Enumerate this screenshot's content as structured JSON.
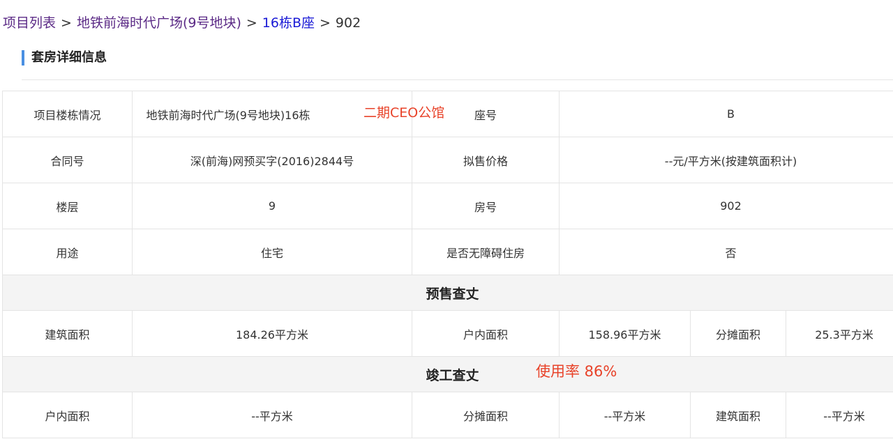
{
  "breadcrumb": {
    "items": [
      "项目列表",
      "地铁前海时代广场(9号地块)",
      "16栋B座",
      "902"
    ],
    "separator": ">"
  },
  "section_title": "套房详细信息",
  "annotations": {
    "project_note": "二期CEO公馆",
    "usage_rate": "使用率 86%"
  },
  "details": {
    "project_building_label": "项目楼栋情况",
    "project_building_value": "地铁前海时代广场(9号地块)16栋",
    "seat_label": "座号",
    "seat_value": "B",
    "contract_label": "合同号",
    "contract_value": "深(前海)网预买字(2016)2844号",
    "price_label": "拟售价格",
    "price_value": "--元/平方米(按建筑面积计)",
    "floor_label": "楼层",
    "floor_value": "9",
    "room_label": "房号",
    "room_value": "902",
    "usage_label": "用途",
    "usage_value": "住宅",
    "barrier_free_label": "是否无障碍住房",
    "barrier_free_value": "否"
  },
  "presale": {
    "title": "预售查丈",
    "building_area_label": "建筑面积",
    "building_area_value": "184.26平方米",
    "indoor_area_label": "户内面积",
    "indoor_area_value": "158.96平方米",
    "shared_area_label": "分摊面积",
    "shared_area_value": "25.3平方米"
  },
  "completion": {
    "title": "竣工查丈",
    "indoor_area_label": "户内面积",
    "indoor_area_value": "--平方米",
    "shared_area_label": "分摊面积",
    "shared_area_value": "--平方米",
    "building_area_label": "建筑面积",
    "building_area_value": "--平方米"
  },
  "colors": {
    "visited_link": "#5b2a86",
    "link": "#1a1ad6",
    "section_accent": "#4a90e2",
    "annotation": "#e8432a",
    "section_row_bg": "#f4f4f4"
  }
}
